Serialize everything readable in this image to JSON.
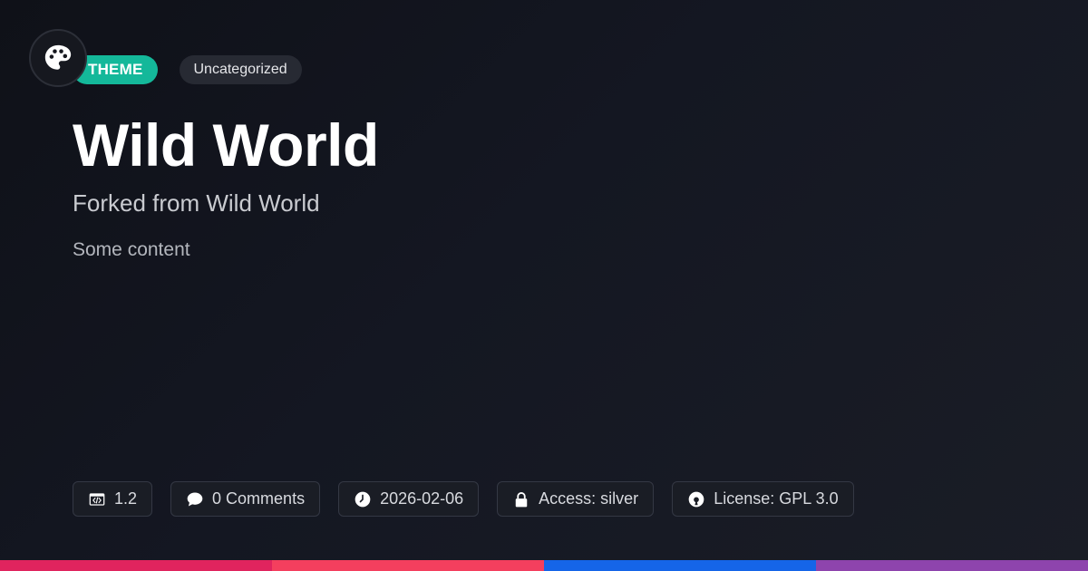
{
  "header": {
    "logo_icon": "palette-icon",
    "type_tag": "THEME",
    "category_tag": "Uncategorized"
  },
  "main": {
    "title": "Wild World",
    "subtitle": "Forked from Wild World",
    "content": "Some content"
  },
  "meta": {
    "version": "1.2",
    "comments": "0 Comments",
    "date": "2026-02-06",
    "access": "Access: silver",
    "license": "License: GPL 3.0"
  },
  "icons": {
    "version": "code-window-icon",
    "comments": "speech-bubble-icon",
    "date": "clock-icon",
    "access": "lock-icon",
    "license": "open-source-icon"
  },
  "colors": {
    "accent": "#14b89a",
    "bar": [
      "#e0245e",
      "#f43f5e",
      "#1565e8",
      "#8e44ad"
    ]
  }
}
